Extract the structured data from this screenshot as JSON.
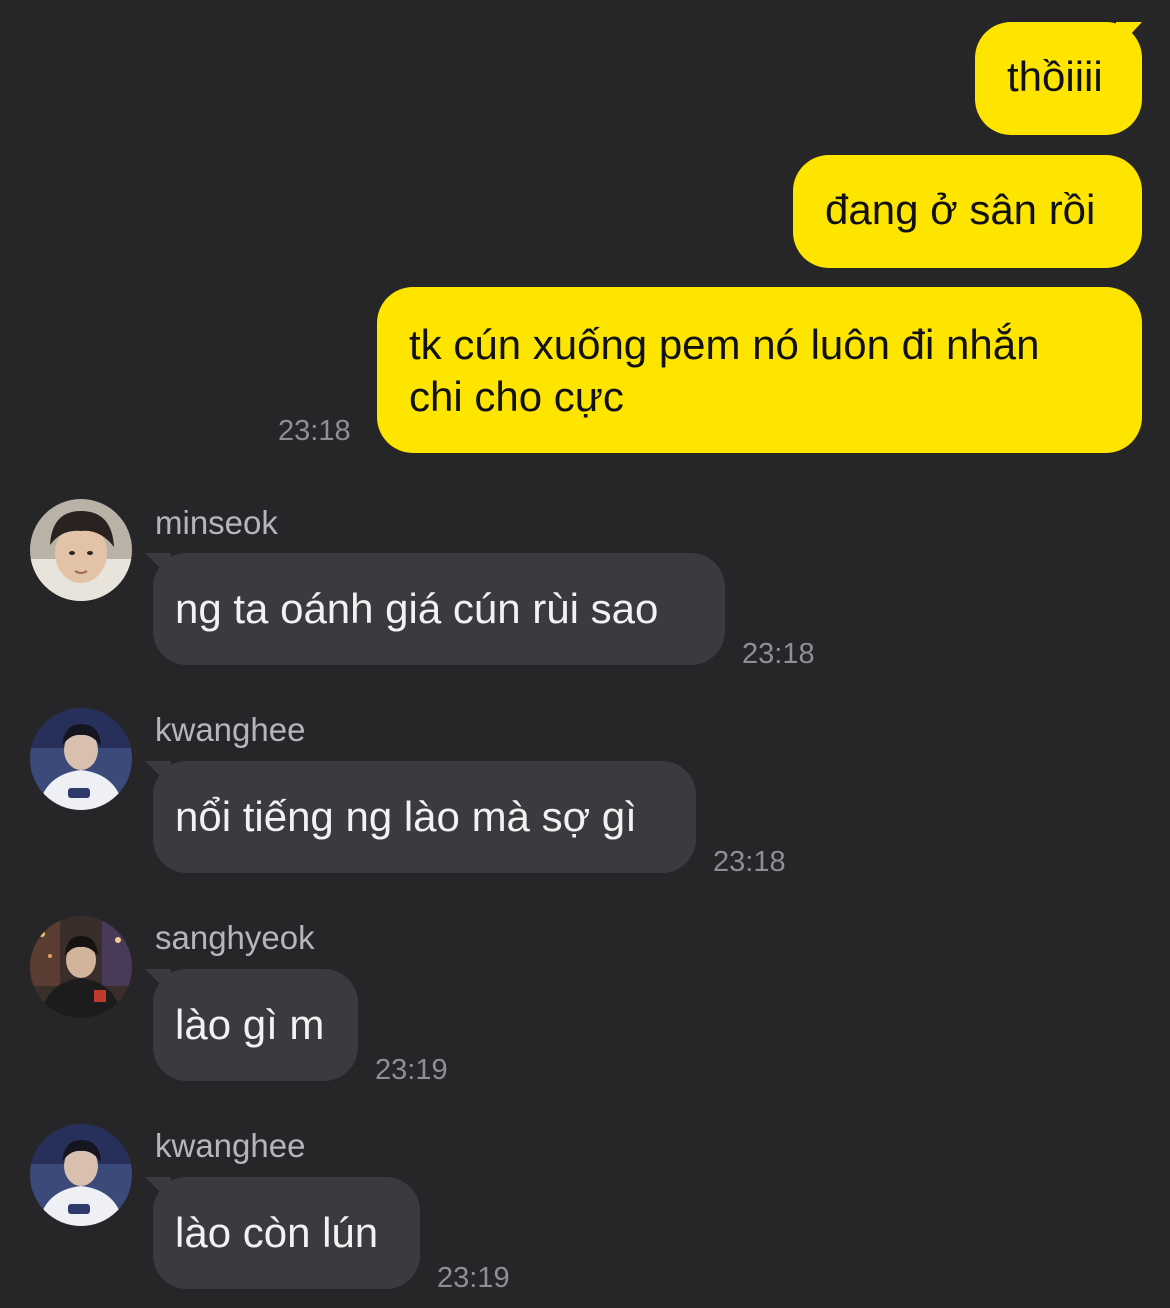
{
  "outgoing": [
    {
      "text": "thồiiii"
    },
    {
      "text": "đang ở sân rồi"
    },
    {
      "text_line1": "tk cún xuống pem nó luôn đi nhắn",
      "text_line2": "chi cho cực",
      "time": "23:18"
    }
  ],
  "incoming": [
    {
      "sender": "minseok",
      "text": "ng ta oánh giá cún rùi sao",
      "time": "23:18",
      "avatar": "minseok-avatar"
    },
    {
      "sender": "kwanghee",
      "text": "nổi tiếng ng lào mà sợ gì",
      "time": "23:18",
      "avatar": "kwanghee-avatar"
    },
    {
      "sender": "sanghyeok",
      "text": "lào gì m",
      "time": "23:19",
      "avatar": "sanghyeok-avatar"
    },
    {
      "sender": "kwanghee",
      "text": "lào còn lún",
      "time": "23:19",
      "avatar": "kwanghee-avatar"
    }
  ],
  "colors": {
    "background": "#262629",
    "outgoing_bubble": "#fee500",
    "incoming_bubble": "#3b3b3f",
    "timestamp": "#8e8e93"
  }
}
